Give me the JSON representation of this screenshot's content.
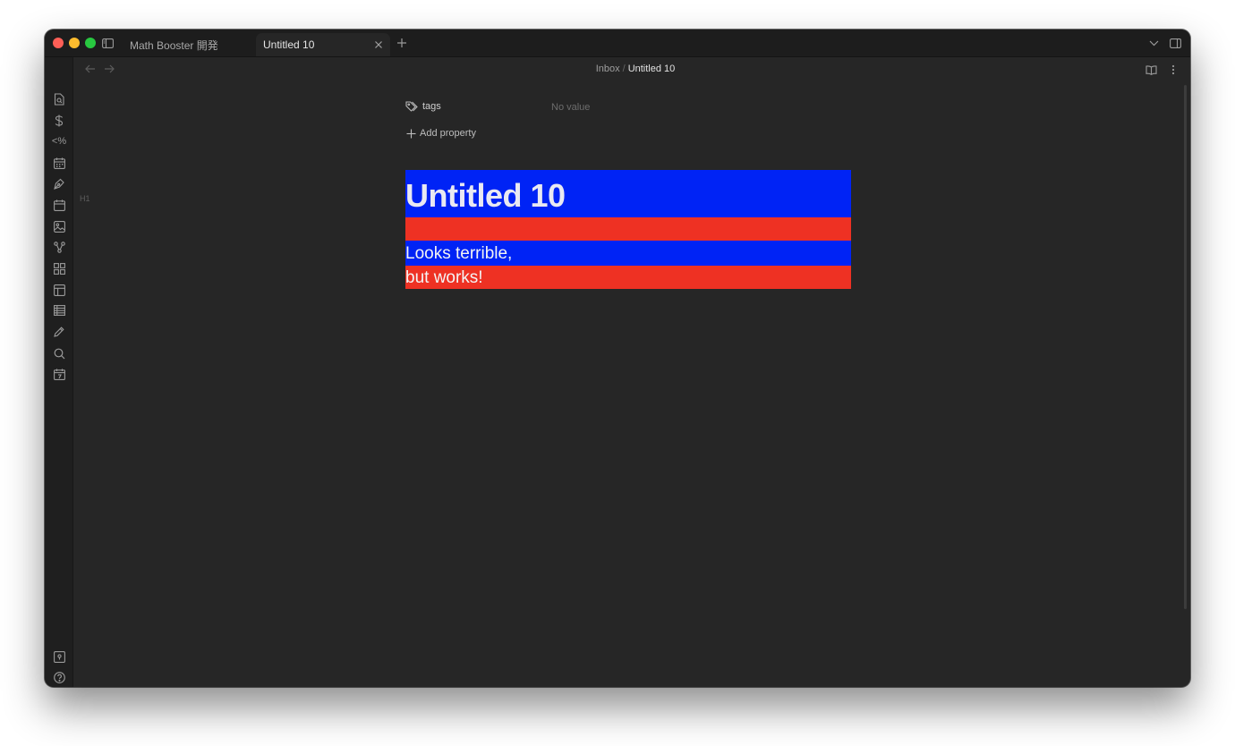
{
  "tabs": [
    {
      "label": "Math Booster 開発",
      "active": false
    },
    {
      "label": "Untitled 10",
      "active": true
    }
  ],
  "breadcrumb": {
    "folder": "Inbox",
    "separator": "/",
    "file": "Untitled 10"
  },
  "properties": {
    "rows": [
      {
        "key": "tags",
        "value": "No value"
      }
    ],
    "add_label": "Add property"
  },
  "gutter": {
    "heading_marker": "H1"
  },
  "note": {
    "title": "Untitled 10",
    "lines": [
      "Looks terrible,",
      "but works!"
    ]
  },
  "colors": {
    "window_bg": "#262626",
    "band_blue": "#0023f5",
    "band_red": "#ee3123",
    "close": "#fe5f57",
    "minimize": "#febc2e",
    "maximize": "#28c840"
  },
  "ribbon_icons": [
    "new-note-icon",
    "dollar-icon",
    "templater-icon",
    "calendar-icon",
    "pen-tool-icon",
    "daily-note-icon",
    "canvas-icon",
    "graph-icon",
    "dashboard-icon",
    "layout-icon",
    "table-icon",
    "pencil-icon",
    "search-icon",
    "weekly-calendar-icon",
    "vault-icon",
    "help-icon",
    "settings-icon"
  ]
}
